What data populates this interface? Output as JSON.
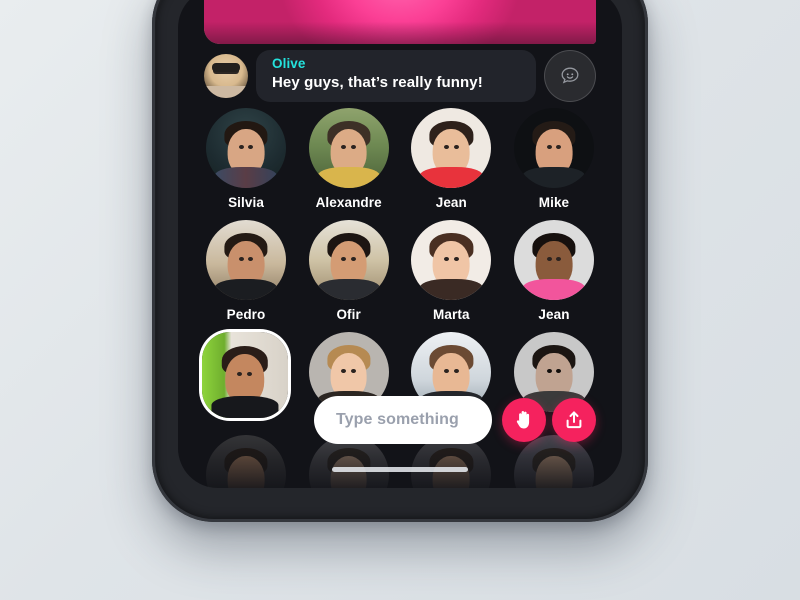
{
  "app": {
    "screen_name": "group-video-call",
    "accent_pink": "#f5225e",
    "accent_cyan": "#24e3dd",
    "screen_bg": "#121318",
    "page_bg": "#e3e7ea"
  },
  "message": {
    "sender": "Olive",
    "text": "Hey guys, that’s really funny!",
    "avatar_name": "olive-avatar",
    "react_button_icon": "emoji-reaction-icon"
  },
  "grid": {
    "rows": [
      [
        {
          "name": "Silvia",
          "avatar": "silvia-avatar"
        },
        {
          "name": "Alexandre",
          "avatar": "alexandre-avatar"
        },
        {
          "name": "Jean",
          "avatar": "jean-avatar"
        },
        {
          "name": "Mike",
          "avatar": "mike-avatar"
        }
      ],
      [
        {
          "name": "Pedro",
          "avatar": "pedro-avatar"
        },
        {
          "name": "Ofir",
          "avatar": "ofir-avatar"
        },
        {
          "name": "Marta",
          "avatar": "marta-avatar"
        },
        {
          "name": "Jean",
          "avatar": "jean-2-avatar"
        }
      ],
      [
        {
          "name": "",
          "avatar": "self-avatar"
        },
        {
          "name": "",
          "avatar": "participant-10-avatar"
        },
        {
          "name": "",
          "avatar": "participant-11-avatar"
        },
        {
          "name": "",
          "avatar": "participant-12-avatar"
        }
      ],
      [
        {
          "name": "",
          "avatar": "participant-13-avatar"
        },
        {
          "name": "",
          "avatar": "participant-14-avatar"
        },
        {
          "name": "",
          "avatar": "participant-15-avatar"
        },
        {
          "name": "",
          "avatar": "participant-16-avatar"
        }
      ]
    ]
  },
  "composer": {
    "placeholder": "Type something",
    "raise_hand_icon": "raise-hand-icon",
    "share_icon": "share-upload-icon"
  },
  "system": {
    "home_indicator": "home-indicator"
  }
}
